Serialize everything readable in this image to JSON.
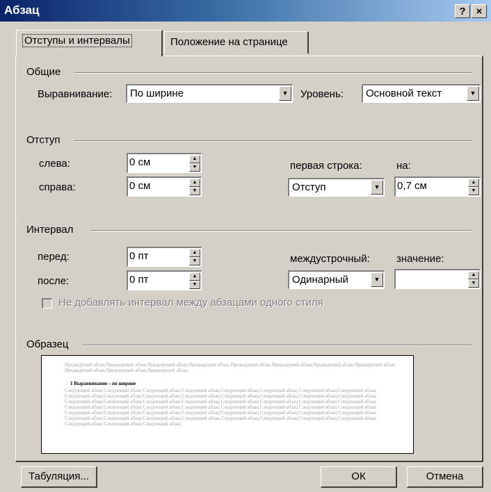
{
  "window": {
    "title": "Абзац",
    "help_label": "?",
    "close_label": "×"
  },
  "tabs": [
    {
      "label": "Отступы и интервалы",
      "accel": "и",
      "active": true
    },
    {
      "label": "Положение на странице",
      "accel": "ж",
      "active": false
    }
  ],
  "general": {
    "group_label": "Общие",
    "alignment_label": "Выравнивание:",
    "alignment_value": "По ширине",
    "level_label": "Уровень:",
    "level_value": "Основной текст"
  },
  "indent": {
    "group_label": "Отступ",
    "left_label": "слева:",
    "left_value": "0 см",
    "right_label": "справа:",
    "right_value": "0 см",
    "first_line_label": "первая строка:",
    "first_line_value": "Отступ",
    "by_label": "на:",
    "by_value": "0,7 см"
  },
  "spacing": {
    "group_label": "Интервал",
    "before_label": "перед:",
    "before_value": "0 пт",
    "after_label": "после:",
    "after_value": "0 пт",
    "line_label": "междустрочный:",
    "line_value": "Одинарный",
    "at_label": "значение:",
    "at_value": "",
    "same_style_label": "Не добавлять интервал между абзацами одного стиля"
  },
  "preview": {
    "group_label": "Образец",
    "previous_text": "Предыдущий абзац Предыдущий абзац Предыдущий абзац Предыдущий абзац Предыдущий абзац Предыдущий абзац Предыдущий абзац Предыдущий абзац Предыдущий абзац Предыдущий абзац Предыдущий абзац",
    "current_text": "1 Выравнивание – по ширине",
    "next_text": "Следующий абзац Следующий абзац Следующий абзац Следующий абзац Следующий абзац Следующий абзац Следующий абзац Следующий абзац Следующий абзац Следующий абзац Следующий абзац Следующий абзац Следующий абзац Следующий абзац Следующий абзац Следующий абзац Следующий абзац Следующий абзац Следующий абзац Следующий абзац Следующий абзац Следующий абзац Следующий абзац Следующий абзац Следующий абзац Следующий абзац Следующий абзац Следующий абзац Следующий абзац Следующий абзац Следующий абзац Следующий абзац Следующий абзац Следующий абзац Следующий абзац Следующий абзац Следующий абзац Следующий абзац Следующий абзац Следующий абзац Следующий абзац Следующий абзац Следующий абзац Следующий абзац Следующий абзац Следующий абзац Следующий абзац Следующий абзац Следующий абзац Следующий абзац Следующий абзац"
  },
  "buttons": {
    "tabs_label": "Табуляция...",
    "ok_label": "ОК",
    "cancel_label": "Отмена"
  }
}
